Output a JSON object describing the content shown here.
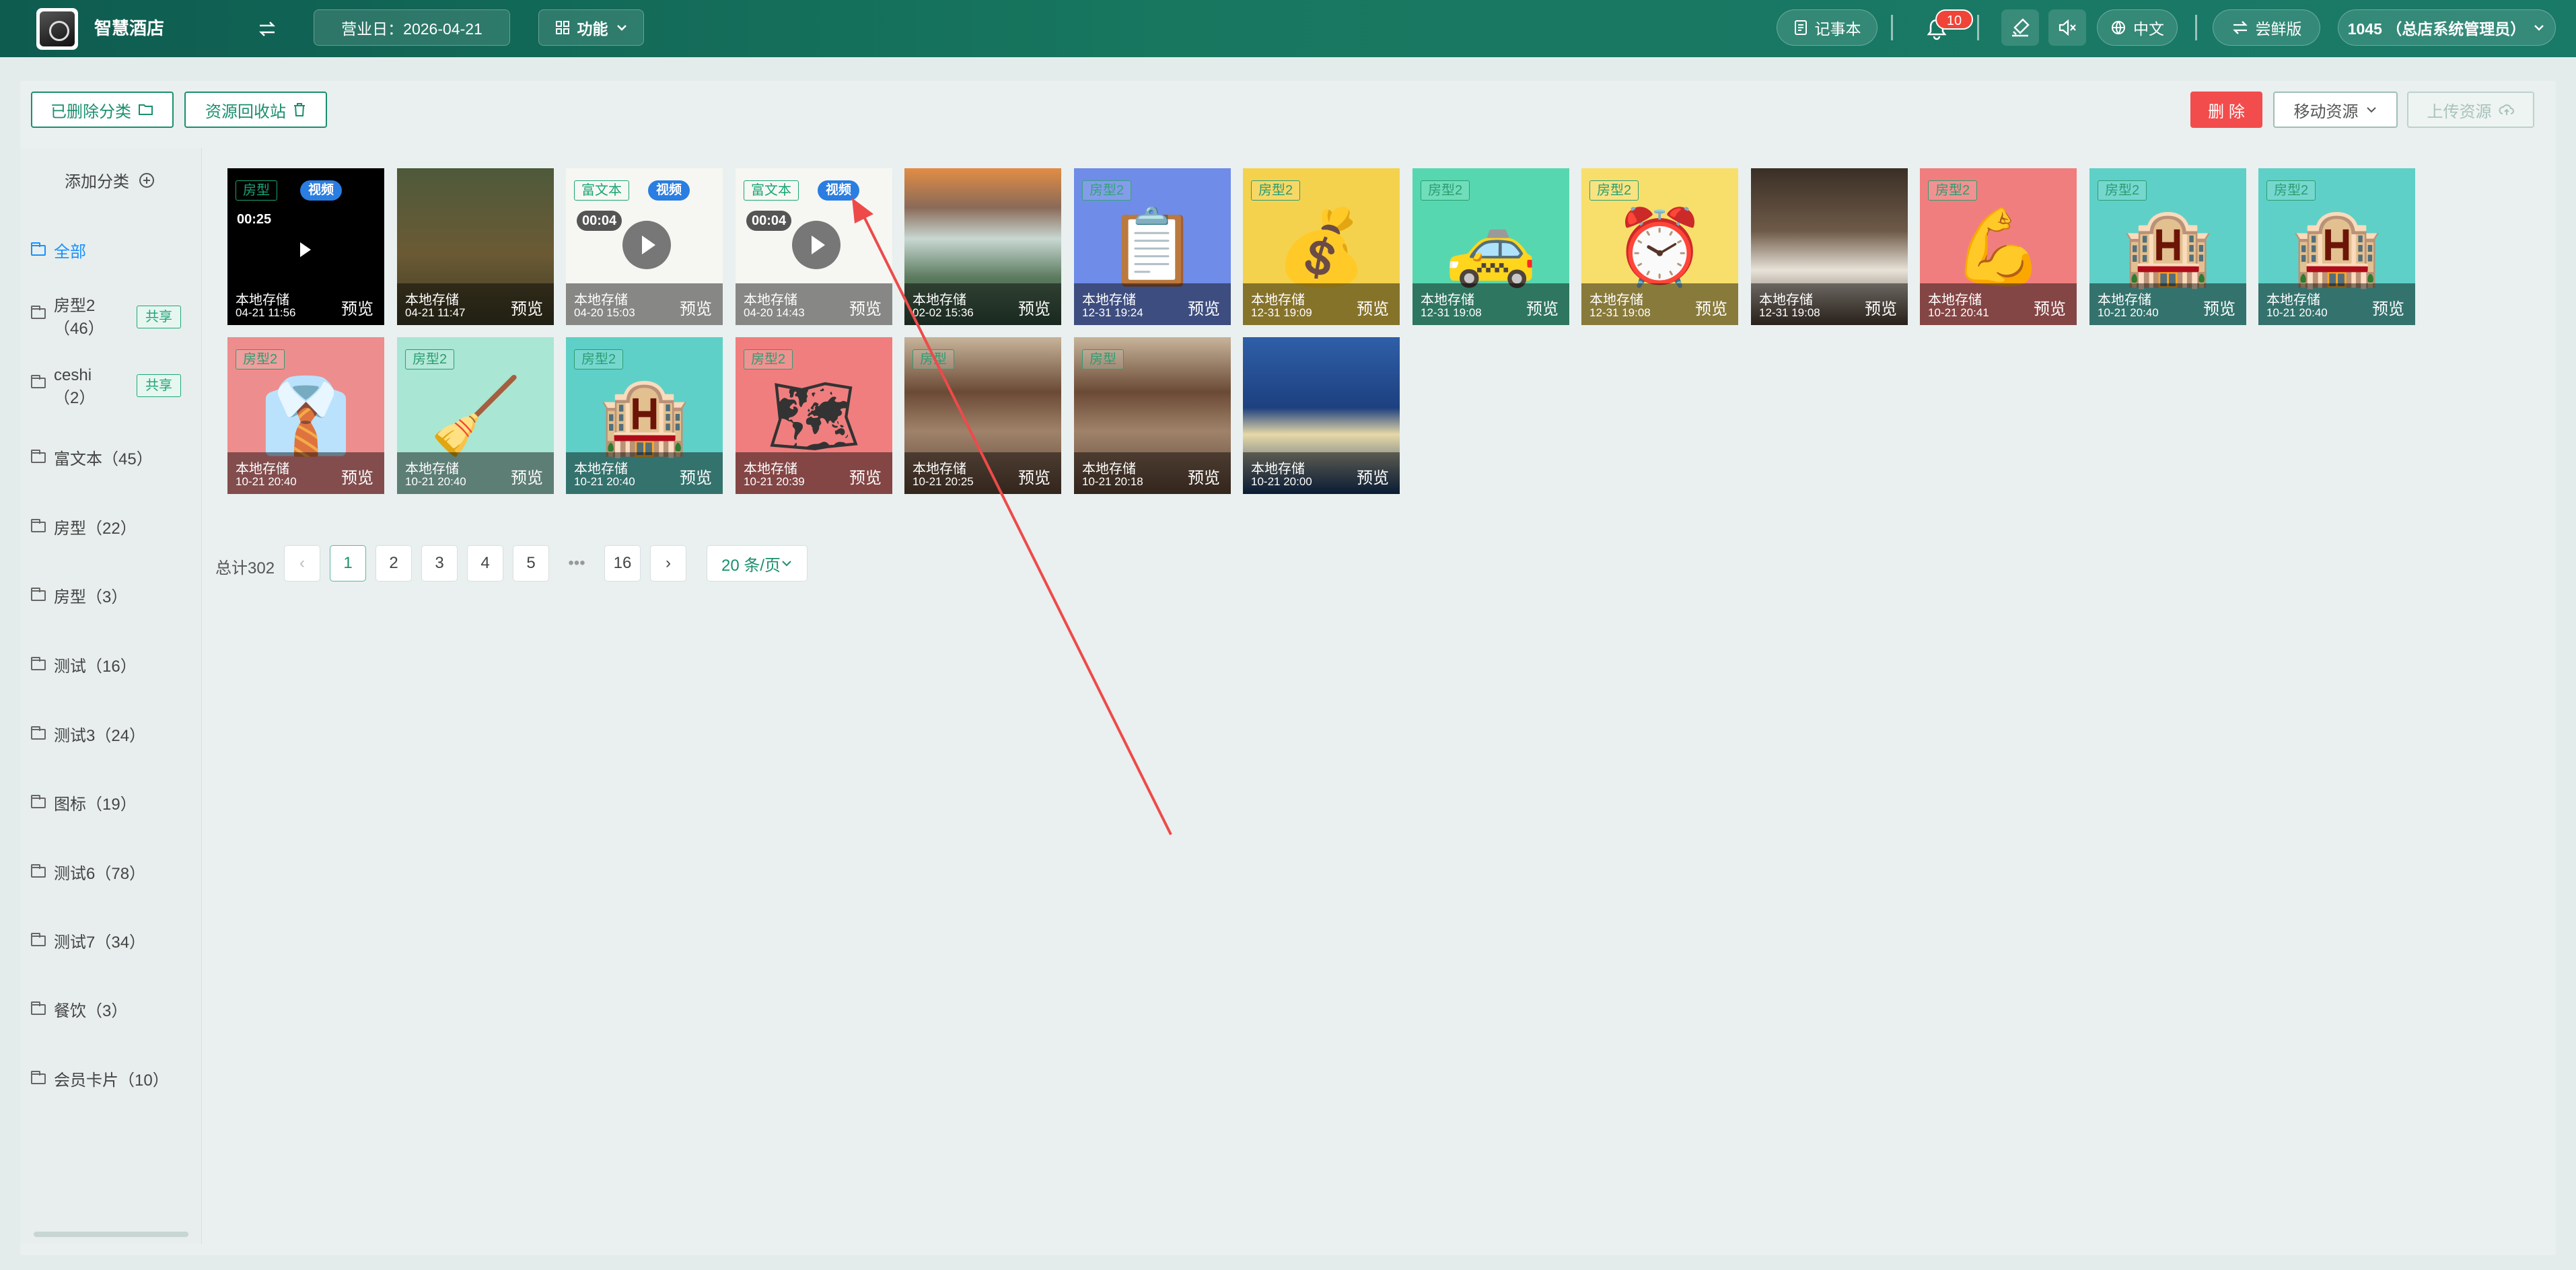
{
  "header": {
    "brand": "智慧酒店",
    "business_date": "营业日：2026-04-21",
    "function_menu": "功能",
    "notebook": "记事本",
    "notification_count": "10",
    "language": "中文",
    "edition": "尝鲜版",
    "user": "1045 （总店系统管理员）"
  },
  "toolbar": {
    "deleted_categories": "已删除分类",
    "recycle_bin": "资源回收站",
    "delete": "删 除",
    "move_resource": "移动资源",
    "upload_resource": "上传资源"
  },
  "sidebar": {
    "add_category": "添加分类",
    "share_label": "共享",
    "items": [
      {
        "label": "全部"
      },
      {
        "label": "房型2",
        "count": "（46）"
      },
      {
        "label": "ceshi",
        "count": "（2）"
      },
      {
        "label": "富文本（45）"
      },
      {
        "label": "房型（22）"
      },
      {
        "label": "房型（3）"
      },
      {
        "label": "测试（16）"
      },
      {
        "label": "测试3（24）"
      },
      {
        "label": "图标（19）"
      },
      {
        "label": "测试6（78）"
      },
      {
        "label": "测试7（34）"
      },
      {
        "label": "餐饮（3）"
      },
      {
        "label": "会员卡片（10）"
      }
    ]
  },
  "resources": [
    {
      "tag": "房型",
      "badge": "视频",
      "duration": "00:25",
      "storage": "本地存储",
      "date": "04-21 11:56",
      "preview": "预览",
      "bg": "#000000",
      "tagcolor": "#19a574"
    },
    {
      "tag": "",
      "storage": "本地存储",
      "date": "04-21 11:47",
      "preview": "预览",
      "bg": "#5b5a32",
      "icon": "moose"
    },
    {
      "tag": "富文本",
      "badge": "视频",
      "duration": "00:04",
      "storage": "本地存储",
      "date": "04-20 15:03",
      "preview": "预览",
      "bg": "#f6f7f2",
      "tagcolor": "#19a574"
    },
    {
      "tag": "富文本",
      "badge": "视频",
      "duration": "00:04",
      "storage": "本地存储",
      "date": "04-20 14:43",
      "preview": "预览",
      "bg": "#f6f7f2",
      "tagcolor": "#19a574"
    },
    {
      "tag": "",
      "storage": "本地存储",
      "date": "02-02 15:36",
      "preview": "预览",
      "bg": "#3b5b4b",
      "icon": "waterfall"
    },
    {
      "tag": "房型2",
      "storage": "本地存储",
      "date": "12-31 19:24",
      "preview": "预览",
      "bg": "#6f8ce8",
      "icon": "📋",
      "tagcolor": "#34a37a"
    },
    {
      "tag": "房型2",
      "storage": "本地存储",
      "date": "12-31 19:09",
      "preview": "预览",
      "bg": "#f5d24d",
      "icon": "💰",
      "tagcolor": "#2a9e72"
    },
    {
      "tag": "房型2",
      "storage": "本地存储",
      "date": "12-31 19:08",
      "preview": "预览",
      "bg": "#57d7b0",
      "icon": "🚕",
      "tagcolor": "#2a9e72"
    },
    {
      "tag": "房型2",
      "storage": "本地存储",
      "date": "12-31 19:08",
      "preview": "预览",
      "bg": "#f8df6b",
      "icon": "⏰",
      "tagcolor": "#2a9e72"
    },
    {
      "tag": "",
      "storage": "本地存储",
      "date": "12-31 19:08",
      "preview": "预览",
      "bg": "#4b3b2f",
      "icon": "room"
    },
    {
      "tag": "房型2",
      "storage": "本地存储",
      "date": "10-21 20:41",
      "preview": "预览",
      "bg": "#f07e7e",
      "icon": "💪",
      "tagcolor": "#2a9e72"
    },
    {
      "tag": "房型2",
      "storage": "本地存储",
      "date": "10-21 20:40",
      "preview": "预览",
      "bg": "#5fd0c7",
      "icon": "🏨",
      "tagcolor": "#2a9e72"
    },
    {
      "tag": "房型2",
      "storage": "本地存储",
      "date": "10-21 20:40",
      "preview": "预览",
      "bg": "#5fd0c7",
      "icon": "🏨",
      "tagcolor": "#2a9e72"
    },
    {
      "tag": "房型2",
      "storage": "本地存储",
      "date": "10-21 20:40",
      "preview": "预览",
      "bg": "#ee8d8d",
      "icon": "👔",
      "tagcolor": "#2a9e72"
    },
    {
      "tag": "房型2",
      "storage": "本地存储",
      "date": "10-21 20:40",
      "preview": "预览",
      "bg": "#a9e6d3",
      "icon": "🧹",
      "tagcolor": "#2a9e72"
    },
    {
      "tag": "房型2",
      "storage": "本地存储",
      "date": "10-21 20:40",
      "preview": "预览",
      "bg": "#5fd0c7",
      "icon": "🏨",
      "tagcolor": "#2a9e72"
    },
    {
      "tag": "房型2",
      "storage": "本地存储",
      "date": "10-21 20:39",
      "preview": "预览",
      "bg": "#f07e7e",
      "icon": "🗺",
      "tagcolor": "#2a9e72"
    },
    {
      "tag": "房型",
      "storage": "本地存储",
      "date": "10-21 20:25",
      "preview": "预览",
      "bg": "#6b4a35",
      "icon": "resort",
      "tagcolor": "#2a9e72"
    },
    {
      "tag": "房型",
      "storage": "本地存储",
      "date": "10-21 20:18",
      "preview": "预览",
      "bg": "#6b4a35",
      "icon": "resort",
      "tagcolor": "#2a9e72"
    },
    {
      "tag": "",
      "storage": "本地存储",
      "date": "10-21 20:00",
      "preview": "预览",
      "bg": "#1a3d6e",
      "icon": "pool"
    }
  ],
  "pagination": {
    "total": "总计302",
    "pages": [
      "1",
      "2",
      "3",
      "4",
      "5"
    ],
    "ellipsis": "•••",
    "last": "16",
    "page_size": "20 条/页"
  }
}
